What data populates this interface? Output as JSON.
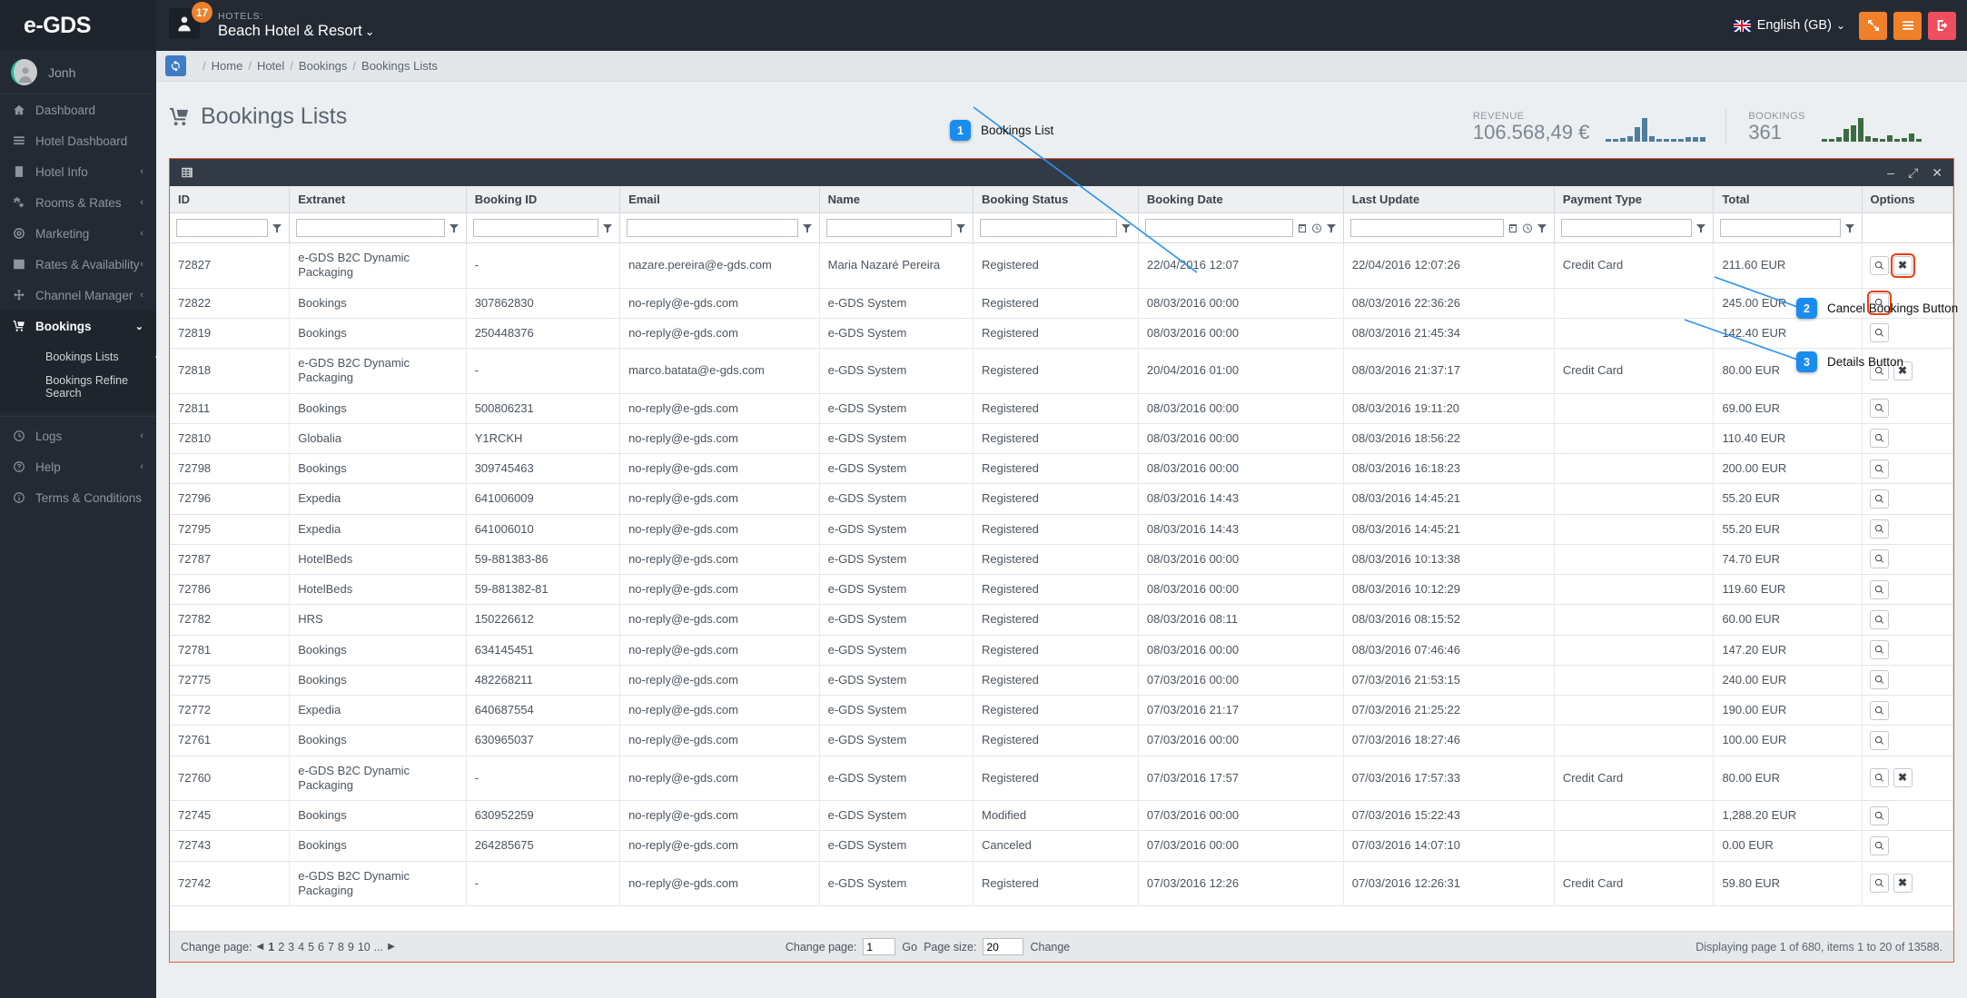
{
  "topbar": {
    "brand": "e-GDS",
    "notification_count": "17",
    "hotels_label": "HOTELS:",
    "hotel_name": "Beach Hotel & Resort",
    "hotel_caret": "⌄",
    "language": "English (GB)",
    "language_caret": "⌄"
  },
  "sidebar": {
    "user": "Jonh",
    "items": [
      {
        "label": "Dashboard",
        "icon": "home-icon",
        "chevron": ""
      },
      {
        "label": "Hotel Dashboard",
        "icon": "list-icon",
        "chevron": ""
      },
      {
        "label": "Hotel Info",
        "icon": "building-icon",
        "chevron": "‹"
      },
      {
        "label": "Rooms & Rates",
        "icon": "gears-icon",
        "chevron": "‹"
      },
      {
        "label": "Marketing",
        "icon": "target-icon",
        "chevron": "‹"
      },
      {
        "label": "Rates & Availability",
        "icon": "bars-icon",
        "chevron": "‹"
      },
      {
        "label": "Channel Manager",
        "icon": "arrows-icon",
        "chevron": "‹"
      },
      {
        "label": "Bookings",
        "icon": "cart-icon",
        "chevron": "⌄"
      }
    ],
    "sub_items": [
      {
        "label": "Bookings Lists"
      },
      {
        "label": "Bookings Refine Search"
      }
    ],
    "bottom_items": [
      {
        "label": "Logs",
        "icon": "clock-icon",
        "chevron": "‹"
      },
      {
        "label": "Help",
        "icon": "question-icon",
        "chevron": "‹"
      },
      {
        "label": "Terms & Conditions",
        "icon": "info-icon",
        "chevron": ""
      }
    ],
    "collapse": "‹"
  },
  "breadcrumb": {
    "items": [
      "Home",
      "Hotel",
      "Bookings",
      "Bookings Lists"
    ],
    "separator": "/"
  },
  "page": {
    "title": "Bookings Lists"
  },
  "stats": [
    {
      "label": "REVENUE",
      "value": "106.568,49 €",
      "spark": [
        3,
        3,
        4,
        6,
        16,
        26,
        6,
        3,
        3,
        3,
        3,
        5,
        5,
        5
      ],
      "color": "#4e7e9e"
    },
    {
      "label": "BOOKINGS",
      "value": "361",
      "spark": [
        3,
        3,
        5,
        14,
        18,
        26,
        6,
        4,
        3,
        7,
        3,
        4,
        9,
        3
      ],
      "color": "#3d6b45"
    }
  ],
  "table": {
    "columns": [
      "ID",
      "Extranet",
      "Booking ID",
      "Email",
      "Name",
      "Booking Status",
      "Booking Date",
      "Last Update",
      "Payment Type",
      "Total",
      "Options"
    ],
    "filter_values": [
      "",
      "",
      "",
      "",
      "",
      "",
      "",
      "",
      "",
      ""
    ],
    "rows": [
      {
        "id": "72827",
        "extranet": "e-GDS B2C Dynamic Packaging",
        "booking_id": "-",
        "email": "nazare.pereira@e-gds.com",
        "name": "Maria Nazaré Pereira",
        "status": "Registered",
        "booking_date": "22/04/2016 12:07",
        "last_update": "22/04/2016 12:07:26",
        "payment_type": "Credit Card",
        "total": "211.60 EUR",
        "has_cancel": true
      },
      {
        "id": "72822",
        "extranet": "Bookings",
        "booking_id": "307862830",
        "email": "no-reply@e-gds.com",
        "name": "e-GDS System",
        "status": "Registered",
        "booking_date": "08/03/2016 00:00",
        "last_update": "08/03/2016 22:36:26",
        "payment_type": "",
        "total": "245.00 EUR",
        "has_cancel": false
      },
      {
        "id": "72819",
        "extranet": "Bookings",
        "booking_id": "250448376",
        "email": "no-reply@e-gds.com",
        "name": "e-GDS System",
        "status": "Registered",
        "booking_date": "08/03/2016 00:00",
        "last_update": "08/03/2016 21:45:34",
        "payment_type": "",
        "total": "142.40 EUR",
        "has_cancel": false
      },
      {
        "id": "72818",
        "extranet": "e-GDS B2C Dynamic Packaging",
        "booking_id": "-",
        "email": "marco.batata@e-gds.com",
        "name": "e-GDS System",
        "status": "Registered",
        "booking_date": "20/04/2016 01:00",
        "last_update": "08/03/2016 21:37:17",
        "payment_type": "Credit Card",
        "total": "80.00 EUR",
        "has_cancel": true
      },
      {
        "id": "72811",
        "extranet": "Bookings",
        "booking_id": "500806231",
        "email": "no-reply@e-gds.com",
        "name": "e-GDS System",
        "status": "Registered",
        "booking_date": "08/03/2016 00:00",
        "last_update": "08/03/2016 19:11:20",
        "payment_type": "",
        "total": "69.00 EUR",
        "has_cancel": false
      },
      {
        "id": "72810",
        "extranet": "Globalia",
        "booking_id": "Y1RCKH",
        "email": "no-reply@e-gds.com",
        "name": "e-GDS System",
        "status": "Registered",
        "booking_date": "08/03/2016 00:00",
        "last_update": "08/03/2016 18:56:22",
        "payment_type": "",
        "total": "110.40 EUR",
        "has_cancel": false
      },
      {
        "id": "72798",
        "extranet": "Bookings",
        "booking_id": "309745463",
        "email": "no-reply@e-gds.com",
        "name": "e-GDS System",
        "status": "Registered",
        "booking_date": "08/03/2016 00:00",
        "last_update": "08/03/2016 16:18:23",
        "payment_type": "",
        "total": "200.00 EUR",
        "has_cancel": false
      },
      {
        "id": "72796",
        "extranet": "Expedia",
        "booking_id": "641006009",
        "email": "no-reply@e-gds.com",
        "name": "e-GDS System",
        "status": "Registered",
        "booking_date": "08/03/2016 14:43",
        "last_update": "08/03/2016 14:45:21",
        "payment_type": "",
        "total": "55.20 EUR",
        "has_cancel": false
      },
      {
        "id": "72795",
        "extranet": "Expedia",
        "booking_id": "641006010",
        "email": "no-reply@e-gds.com",
        "name": "e-GDS System",
        "status": "Registered",
        "booking_date": "08/03/2016 14:43",
        "last_update": "08/03/2016 14:45:21",
        "payment_type": "",
        "total": "55.20 EUR",
        "has_cancel": false
      },
      {
        "id": "72787",
        "extranet": "HotelBeds",
        "booking_id": "59-881383-86",
        "email": "no-reply@e-gds.com",
        "name": "e-GDS System",
        "status": "Registered",
        "booking_date": "08/03/2016 00:00",
        "last_update": "08/03/2016 10:13:38",
        "payment_type": "",
        "total": "74.70 EUR",
        "has_cancel": false
      },
      {
        "id": "72786",
        "extranet": "HotelBeds",
        "booking_id": "59-881382-81",
        "email": "no-reply@e-gds.com",
        "name": "e-GDS System",
        "status": "Registered",
        "booking_date": "08/03/2016 00:00",
        "last_update": "08/03/2016 10:12:29",
        "payment_type": "",
        "total": "119.60 EUR",
        "has_cancel": false
      },
      {
        "id": "72782",
        "extranet": "HRS",
        "booking_id": "150226612",
        "email": "no-reply@e-gds.com",
        "name": "e-GDS System",
        "status": "Registered",
        "booking_date": "08/03/2016 08:11",
        "last_update": "08/03/2016 08:15:52",
        "payment_type": "",
        "total": "60.00 EUR",
        "has_cancel": false
      },
      {
        "id": "72781",
        "extranet": "Bookings",
        "booking_id": "634145451",
        "email": "no-reply@e-gds.com",
        "name": "e-GDS System",
        "status": "Registered",
        "booking_date": "08/03/2016 00:00",
        "last_update": "08/03/2016 07:46:46",
        "payment_type": "",
        "total": "147.20 EUR",
        "has_cancel": false
      },
      {
        "id": "72775",
        "extranet": "Bookings",
        "booking_id": "482268211",
        "email": "no-reply@e-gds.com",
        "name": "e-GDS System",
        "status": "Registered",
        "booking_date": "07/03/2016 00:00",
        "last_update": "07/03/2016 21:53:15",
        "payment_type": "",
        "total": "240.00 EUR",
        "has_cancel": false
      },
      {
        "id": "72772",
        "extranet": "Expedia",
        "booking_id": "640687554",
        "email": "no-reply@e-gds.com",
        "name": "e-GDS System",
        "status": "Registered",
        "booking_date": "07/03/2016 21:17",
        "last_update": "07/03/2016 21:25:22",
        "payment_type": "",
        "total": "190.00 EUR",
        "has_cancel": false
      },
      {
        "id": "72761",
        "extranet": "Bookings",
        "booking_id": "630965037",
        "email": "no-reply@e-gds.com",
        "name": "e-GDS System",
        "status": "Registered",
        "booking_date": "07/03/2016 00:00",
        "last_update": "07/03/2016 18:27:46",
        "payment_type": "",
        "total": "100.00 EUR",
        "has_cancel": false
      },
      {
        "id": "72760",
        "extranet": "e-GDS B2C Dynamic Packaging",
        "booking_id": "-",
        "email": "no-reply@e-gds.com",
        "name": "e-GDS System",
        "status": "Registered",
        "booking_date": "07/03/2016 17:57",
        "last_update": "07/03/2016 17:57:33",
        "payment_type": "Credit Card",
        "total": "80.00 EUR",
        "has_cancel": true
      },
      {
        "id": "72745",
        "extranet": "Bookings",
        "booking_id": "630952259",
        "email": "no-reply@e-gds.com",
        "name": "e-GDS System",
        "status": "Modified",
        "booking_date": "07/03/2016 00:00",
        "last_update": "07/03/2016 15:22:43",
        "payment_type": "",
        "total": "1,288.20 EUR",
        "has_cancel": false
      },
      {
        "id": "72743",
        "extranet": "Bookings",
        "booking_id": "264285675",
        "email": "no-reply@e-gds.com",
        "name": "e-GDS System",
        "status": "Canceled",
        "booking_date": "07/03/2016 00:00",
        "last_update": "07/03/2016 14:07:10",
        "payment_type": "",
        "total": "0.00 EUR",
        "has_cancel": false
      },
      {
        "id": "72742",
        "extranet": "e-GDS B2C Dynamic Packaging",
        "booking_id": "-",
        "email": "no-reply@e-gds.com",
        "name": "e-GDS System",
        "status": "Registered",
        "booking_date": "07/03/2016 12:26",
        "last_update": "07/03/2016 12:26:31",
        "payment_type": "Credit Card",
        "total": "59.80 EUR",
        "has_cancel": true
      }
    ]
  },
  "pager": {
    "change_page_label": "Change page:",
    "prev": "◀",
    "next": "▶",
    "pages": [
      "1",
      "2",
      "3",
      "4",
      "5",
      "6",
      "7",
      "8",
      "9",
      "10",
      "..."
    ],
    "current_page": "1",
    "goto_label": "Change page:",
    "goto_value": "1",
    "go_label": "Go",
    "page_size_label": "Page size:",
    "page_size_value": "20",
    "change_label": "Change",
    "status": "Displaying page 1 of 680, items 1 to 20 of 13588."
  },
  "annotations": [
    {
      "num": "1",
      "label": "Bookings List"
    },
    {
      "num": "2",
      "label": "Cancel Bookings Button"
    },
    {
      "num": "3",
      "label": "Details Button"
    }
  ]
}
